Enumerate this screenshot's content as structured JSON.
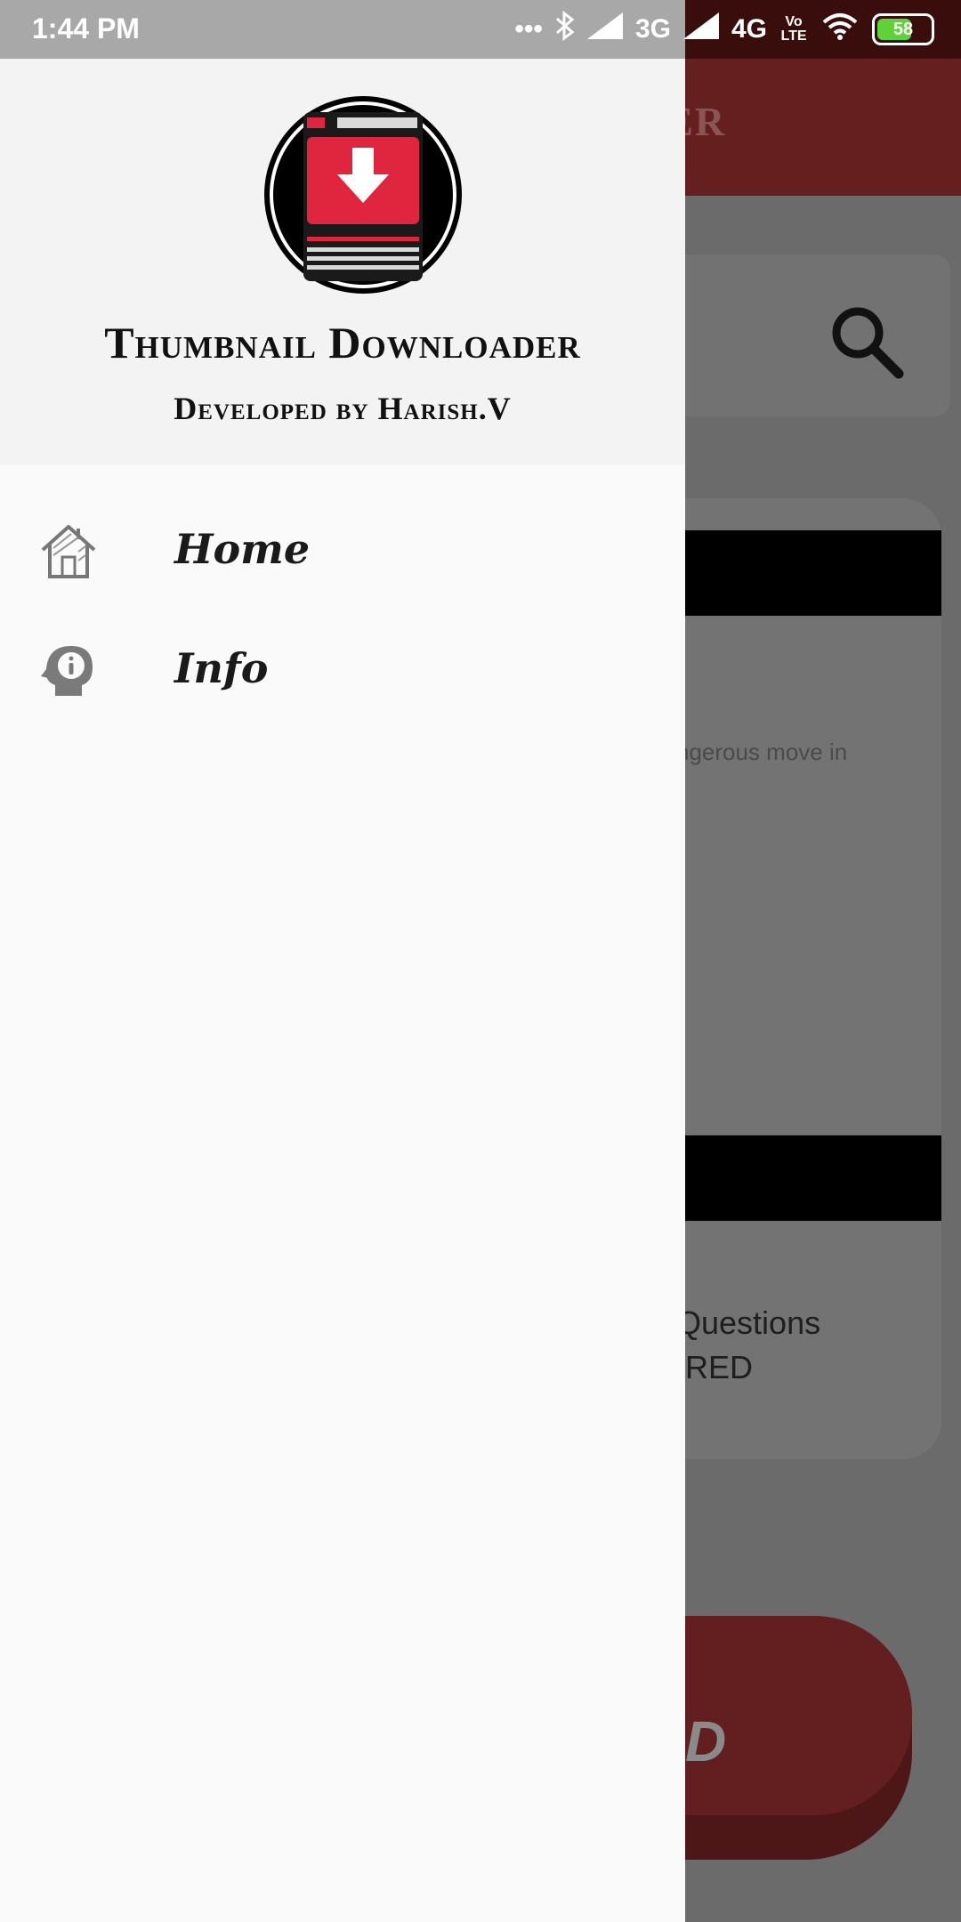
{
  "status_bar": {
    "time": "1:44 PM",
    "network_1": "3G",
    "network_2": "4G",
    "volte": "Vo LTE",
    "battery": "58",
    "icons": [
      "dots-icon",
      "bluetooth-icon",
      "signal-icon",
      "wifi-icon",
      "battery-icon"
    ]
  },
  "drawer": {
    "app_title": "Thumbnail Downloader",
    "developer": "Developed by Harish.V",
    "logo_icon": "download-logo-icon",
    "items": [
      {
        "label": "Home",
        "icon": "home-icon"
      },
      {
        "label": "Info",
        "icon": "info-head-icon"
      }
    ]
  },
  "background": {
    "appbar_title_fragment": "OADER",
    "card_text_1": "ngerous move in",
    "card_text_2": "Questions",
    "card_text_3": "IRED",
    "button_fragment": "D",
    "colors": {
      "appbar": "#651f1f",
      "button": "#631f1f",
      "scrim": "#6b6b6b"
    }
  },
  "colors": {
    "drawer_bg": "#fafafa",
    "header_bg": "#f3f3f3",
    "logo_red": "#e0263f",
    "status_bar": "#a8a8a8"
  }
}
